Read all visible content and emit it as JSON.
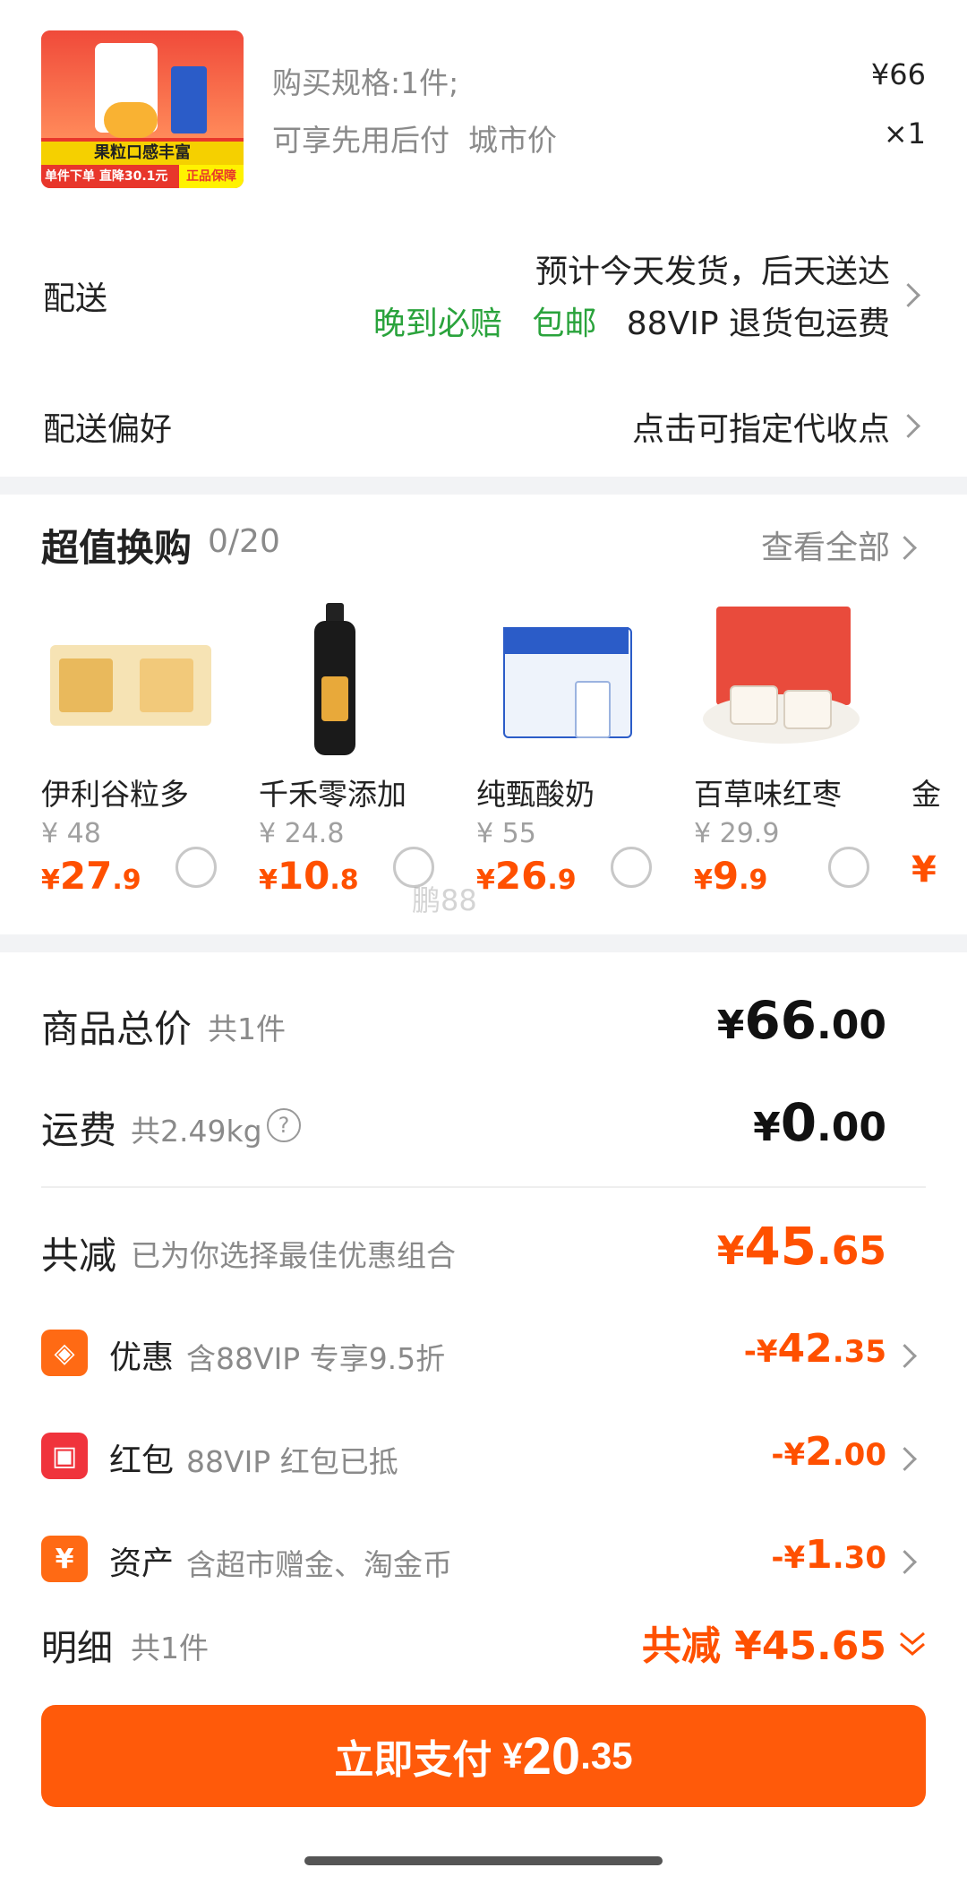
{
  "product": {
    "spec_label": "购买规格:1件;",
    "tags": "可享先用后付  城市价",
    "price": "¥66",
    "qty": "×1",
    "thumb_text": "果粒口感丰富",
    "thumb_banner": "单件下单 直降30.1元",
    "thumb_badge": "正品保障"
  },
  "delivery": {
    "label": "配送",
    "line1": "预计今天发货，后天送达",
    "tag1": "晚到必赔",
    "tag2": "包邮",
    "tag3": "88VIP 退货包运费"
  },
  "preference": {
    "label": "配送偏好",
    "value": "点击可指定代收点"
  },
  "deals": {
    "title": "超值换购",
    "count": "0/20",
    "view_all": "查看全部",
    "items": [
      {
        "name": "伊利谷粒多",
        "orig": "¥ 48",
        "cur": "¥",
        "int": "27",
        "dec": ".9"
      },
      {
        "name": "千禾零添加",
        "orig": "¥ 24.8",
        "cur": "¥",
        "int": "10",
        "dec": ".8"
      },
      {
        "name": "纯甄酸奶",
        "orig": "¥ 55",
        "cur": "¥",
        "int": "26",
        "dec": ".9"
      },
      {
        "name": "百草味红枣",
        "orig": "¥ 29.9",
        "cur": "¥",
        "int": "9",
        "dec": ".9"
      }
    ],
    "watermark": "鹏88"
  },
  "summary": {
    "goods_label": "商品总价",
    "goods_sub": "共1件",
    "goods_cur": "¥",
    "goods_int": "66",
    "goods_dec": ".00",
    "ship_label": "运费",
    "ship_sub": "共2.49kg",
    "ship_cur": "¥",
    "ship_int": "0",
    "ship_dec": ".00",
    "reduce_label": "共减",
    "reduce_sub": "已为你选择最佳优惠组合",
    "reduce_cur": "¥",
    "reduce_int": "45",
    "reduce_dec": ".65",
    "discounts": [
      {
        "label": "优惠",
        "desc": "含88VIP 专享9.5折",
        "sign": "-¥",
        "int": "42",
        "dec": ".35",
        "icon": "tag-icon"
      },
      {
        "label": "红包",
        "desc": "88VIP 红包已抵",
        "sign": "-¥",
        "int": "2",
        "dec": ".00",
        "icon": "red-packet-icon"
      },
      {
        "label": "资产",
        "desc": "含超市赠金、淘金币",
        "sign": "-¥",
        "int": "1",
        "dec": ".30",
        "icon": "yuan-icon"
      }
    ],
    "detail_label": "明细",
    "detail_sub": "共1件",
    "detail_total": "共减 ¥45.65"
  },
  "pay": {
    "label": "立即支付",
    "cur": "¥",
    "int": "20",
    "dec": ".35"
  },
  "colors": {
    "accent": "#ff5000",
    "green": "#2aa33c",
    "button": "#ff5a0a"
  }
}
